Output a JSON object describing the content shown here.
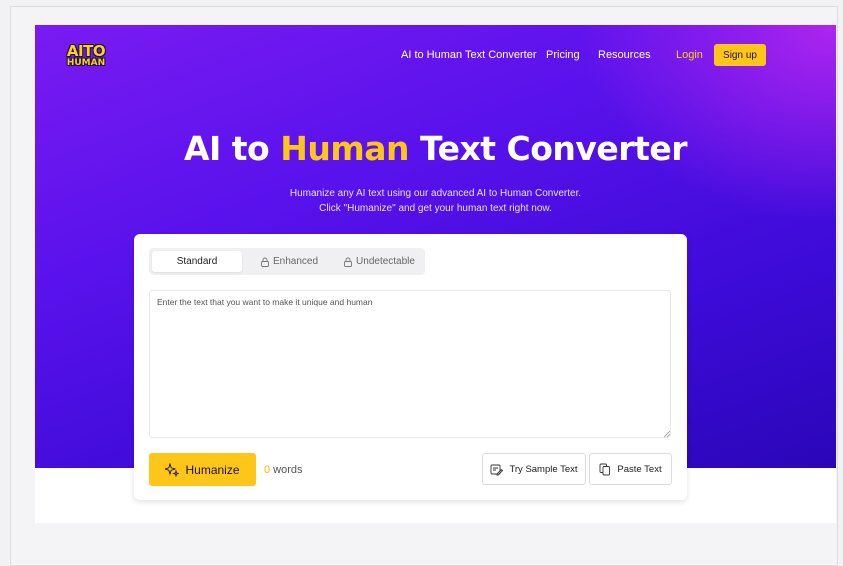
{
  "brand": {
    "logo_line1": "AITO",
    "logo_line2": "HUMAN"
  },
  "nav": {
    "items": [
      {
        "label": "AI to Human Text Converter"
      },
      {
        "label": "Pricing"
      },
      {
        "label": "Resources"
      }
    ],
    "login": "Login",
    "signup": "Sign up"
  },
  "hero": {
    "title_before": "AI to ",
    "title_highlight": "Human",
    "title_after": " Text Converter",
    "subtitle_line1": "Humanize any AI text using our advanced AI to Human Converter.",
    "subtitle_line2": "Click \"Humanize\" and get your human text right now."
  },
  "editor": {
    "tabs": [
      {
        "label": "Standard",
        "locked": false
      },
      {
        "label": "Enhanced",
        "locked": true
      },
      {
        "label": "Undetectable",
        "locked": true
      }
    ],
    "placeholder": "Enter the text that you want to make it unique and human",
    "value": "",
    "humanize_label": "Humanize",
    "word_count": "0",
    "word_label": " words",
    "sample_label": "Try Sample Text",
    "paste_label": "Paste Text"
  },
  "colors": {
    "accent": "#ffc61a",
    "hero_start": "#7a1bf2",
    "hero_end": "#2a06b8"
  },
  "icons": [
    "sparkle-icon",
    "lock-icon",
    "sample-text-icon",
    "paste-icon"
  ]
}
